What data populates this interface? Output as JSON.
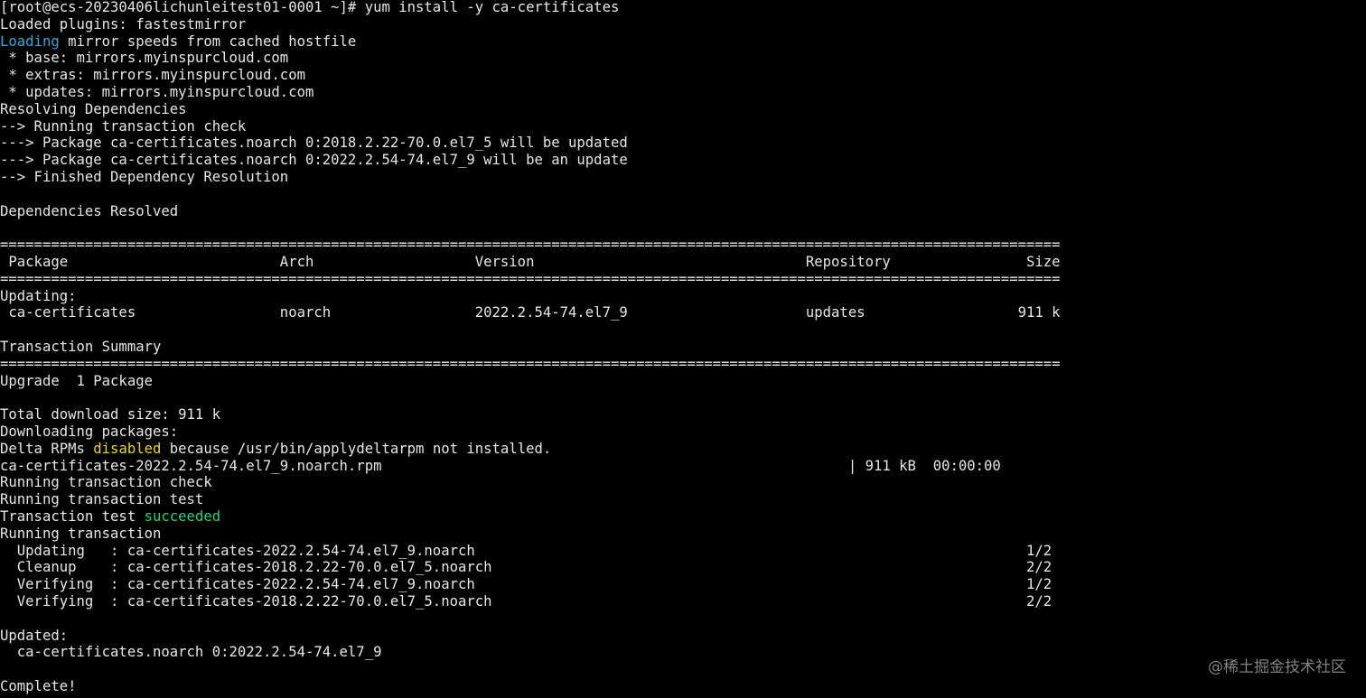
{
  "terminal": {
    "background": "#000000",
    "text_color": "#e6e6e6",
    "lines": [
      {
        "segments": [
          {
            "text": "[root@ecs-20230406lichunleitest01-0001 ~]# yum install -y ca-certificates"
          }
        ]
      },
      {
        "segments": [
          {
            "text": "Loaded plugins: fastestmirror"
          }
        ]
      },
      {
        "segments": [
          {
            "text": "Loading",
            "color": "blue"
          },
          {
            "text": " mirror speeds from cached hostfile"
          }
        ]
      },
      {
        "segments": [
          {
            "text": " * base: mirrors.myinspurcloud.com"
          }
        ]
      },
      {
        "segments": [
          {
            "text": " * extras: mirrors.myinspurcloud.com"
          }
        ]
      },
      {
        "segments": [
          {
            "text": " * updates: mirrors.myinspurcloud.com"
          }
        ]
      },
      {
        "segments": [
          {
            "text": "Resolving Dependencies"
          }
        ]
      },
      {
        "segments": [
          {
            "text": "--> Running transaction check"
          }
        ]
      },
      {
        "segments": [
          {
            "text": "---> Package ca-certificates.noarch 0:2018.2.22-70.0.el7_5 will be updated"
          }
        ]
      },
      {
        "segments": [
          {
            "text": "---> Package ca-certificates.noarch 0:2022.2.54-74.el7_9 will be an update"
          }
        ]
      },
      {
        "segments": [
          {
            "text": "--> Finished Dependency Resolution"
          }
        ]
      },
      {
        "segments": [
          {
            "text": ""
          }
        ]
      },
      {
        "segments": [
          {
            "text": "Dependencies Resolved"
          }
        ]
      },
      {
        "segments": [
          {
            "text": ""
          }
        ]
      },
      {
        "segments": [
          {
            "text": "============================================================================================================================="
          }
        ]
      },
      {
        "segments": [
          {
            "text": " Package                         Arch                   Version                                Repository                Size"
          }
        ]
      },
      {
        "segments": [
          {
            "text": "============================================================================================================================="
          }
        ]
      },
      {
        "segments": [
          {
            "text": "Updating:"
          }
        ]
      },
      {
        "segments": [
          {
            "text": " ca-certificates                 noarch                 2022.2.54-74.el7_9                     updates                  911 k"
          }
        ]
      },
      {
        "segments": [
          {
            "text": ""
          }
        ]
      },
      {
        "segments": [
          {
            "text": "Transaction Summary"
          }
        ]
      },
      {
        "segments": [
          {
            "text": "============================================================================================================================="
          }
        ]
      },
      {
        "segments": [
          {
            "text": "Upgrade  1 Package"
          }
        ]
      },
      {
        "segments": [
          {
            "text": ""
          }
        ]
      },
      {
        "segments": [
          {
            "text": "Total download size: 911 k"
          }
        ]
      },
      {
        "segments": [
          {
            "text": "Downloading packages:"
          }
        ]
      },
      {
        "segments": [
          {
            "text": "Delta RPMs "
          },
          {
            "text": "disabled",
            "color": "yellow"
          },
          {
            "text": " because /usr/bin/applydeltarpm not installed."
          }
        ]
      },
      {
        "segments": [
          {
            "text": "ca-certificates-2022.2.54-74.el7_9.noarch.rpm                                                       | 911 kB  00:00:00"
          }
        ]
      },
      {
        "segments": [
          {
            "text": "Running transaction check"
          }
        ]
      },
      {
        "segments": [
          {
            "text": "Running transaction test"
          }
        ]
      },
      {
        "segments": [
          {
            "text": "Transaction test "
          },
          {
            "text": "succeeded",
            "color": "green"
          }
        ]
      },
      {
        "segments": [
          {
            "text": "Running transaction"
          }
        ]
      },
      {
        "segments": [
          {
            "text": "  Updating   : ca-certificates-2022.2.54-74.el7_9.noarch                                                                 1/2"
          }
        ]
      },
      {
        "segments": [
          {
            "text": "  Cleanup    : ca-certificates-2018.2.22-70.0.el7_5.noarch                                                               2/2"
          }
        ]
      },
      {
        "segments": [
          {
            "text": "  Verifying  : ca-certificates-2022.2.54-74.el7_9.noarch                                                                 1/2"
          }
        ]
      },
      {
        "segments": [
          {
            "text": "  Verifying  : ca-certificates-2018.2.22-70.0.el7_5.noarch                                                               2/2"
          }
        ]
      },
      {
        "segments": [
          {
            "text": ""
          }
        ]
      },
      {
        "segments": [
          {
            "text": "Updated:"
          }
        ]
      },
      {
        "segments": [
          {
            "text": "  ca-certificates.noarch 0:2022.2.54-74.el7_9"
          }
        ]
      },
      {
        "segments": [
          {
            "text": ""
          }
        ]
      },
      {
        "segments": [
          {
            "text": "Complete!"
          }
        ]
      }
    ]
  },
  "watermark": {
    "text": "@稀土掘金技术社区"
  },
  "colors": {
    "blue": "#3aa7d8",
    "yellow": "#e6d43a",
    "green": "#27d27a"
  }
}
